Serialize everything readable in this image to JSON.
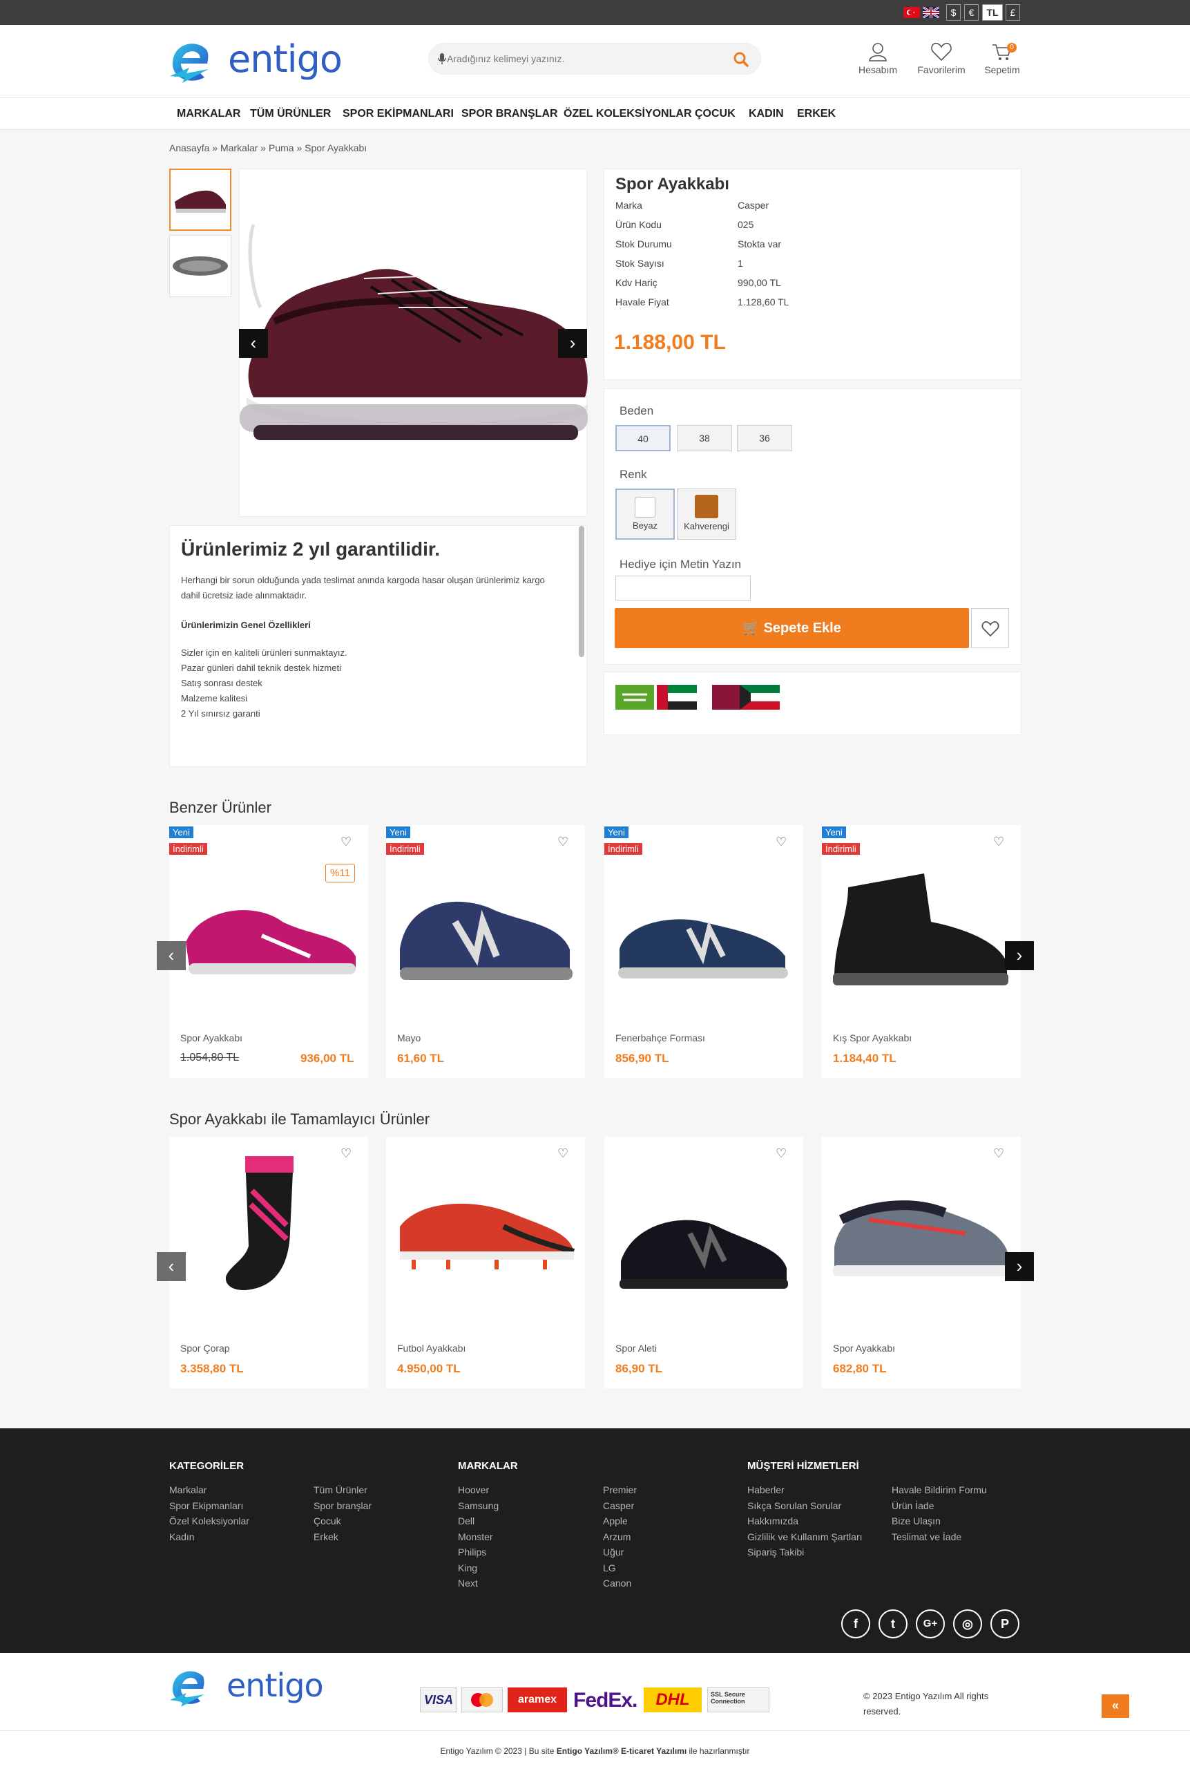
{
  "topbar": {
    "currencies": [
      "$",
      "€",
      "TL",
      "£"
    ],
    "active_currency": "TL",
    "languages": [
      "tr-flag",
      "uk-flag"
    ]
  },
  "header": {
    "logo_text": "entigo",
    "search_placeholder": "Aradığınız kelimeyi yazınız.",
    "account_label": "Hesabım",
    "favorites_label": "Favorilerim",
    "cart_label": "Sepetim",
    "cart_count": "0"
  },
  "nav": [
    "MARKALAR",
    "TÜM ÜRÜNLER",
    "SPOR EKİPMANLARI",
    "SPOR BRANŞLAR",
    "ÖZEL KOLEKSİYONLAR",
    "ÇOCUK",
    "KADIN",
    "ERKEK"
  ],
  "breadcrumb": [
    "Anasayfa",
    "Markalar",
    "Puma",
    "Spor Ayakkabı"
  ],
  "product": {
    "title": "Spor Ayakkabı",
    "specs": [
      {
        "label": "Marka",
        "value": "Casper"
      },
      {
        "label": "Ürün Kodu",
        "value": "025"
      },
      {
        "label": "Stok Durumu",
        "value": "Stokta var"
      },
      {
        "label": "Stok Sayısı",
        "value": "1"
      },
      {
        "label": "Kdv Hariç",
        "value": "990,00 TL"
      },
      {
        "label": "Havale Fiyat",
        "value": "1.128,60 TL"
      }
    ],
    "price": "1.188,00 TL",
    "size_label": "Beden",
    "sizes": [
      "40",
      "38",
      "36"
    ],
    "selected_size": "40",
    "color_label": "Renk",
    "colors": [
      {
        "name": "Beyaz",
        "hex": "#ffffff"
      },
      {
        "name": "Kahverengi",
        "hex": "#b5651d"
      }
    ],
    "gift_label": "Hediye için Metin Yazın",
    "gift_value": "",
    "add_to_cart": "Sepete Ekle"
  },
  "warranty": {
    "title": "Ürünlerimiz 2 yıl garantilidir.",
    "intro": "Herhangi bir sorun olduğunda yada teslimat anında kargoda hasar oluşan ürünlerimiz kargo dahil ücretsiz iade alınmaktadır.",
    "features_title": "Ürünlerimizin Genel Özellikleri",
    "features": [
      "Sizler için en kaliteli ürünleri sunmaktayız.",
      "Pazar günleri dahil teknik destek hizmeti",
      "Satış sonrası destek",
      "Malzeme kalitesi",
      "2 Yıl sınırsız garanti"
    ]
  },
  "similar": {
    "title": "Benzer Ürünler",
    "new_badge": "Yeni",
    "sale_badge": "İndirimli",
    "items": [
      {
        "name": "Spor Ayakkabı",
        "old_price": "1.054,80 TL",
        "price": "936,00 TL",
        "discount": "%11"
      },
      {
        "name": "Mayo",
        "old_price": "",
        "price": "61,60 TL",
        "discount": ""
      },
      {
        "name": "Fenerbahçe Forması",
        "old_price": "",
        "price": "856,90 TL",
        "discount": ""
      },
      {
        "name": "Kış Spor Ayakkabı",
        "old_price": "",
        "price": "1.184,40 TL",
        "discount": ""
      }
    ]
  },
  "complementary": {
    "title": "Spor Ayakkabı ile Tamamlayıcı Ürünler",
    "items": [
      {
        "name": "Spor Çorap",
        "price": "3.358,80 TL"
      },
      {
        "name": "Futbol Ayakkabı",
        "price": "4.950,00 TL"
      },
      {
        "name": "Spor Aleti",
        "price": "86,90 TL"
      },
      {
        "name": "Spor Ayakkabı",
        "price": "682,80 TL"
      }
    ]
  },
  "footer": {
    "categories_title": "KATEGORİLER",
    "categories_col1": [
      "Markalar",
      "Spor Ekipmanları",
      "Özel Koleksiyonlar",
      "Kadın"
    ],
    "categories_col2": [
      "Tüm Ürünler",
      "Spor branşlar",
      "Çocuk",
      "Erkek"
    ],
    "brands_title": "MARKALAR",
    "brands_col1": [
      "Hoover",
      "Samsung",
      "Dell",
      "Monster",
      "Philips",
      "King",
      "Next"
    ],
    "brands_col2": [
      "Premier",
      "Casper",
      "Apple",
      "Arzum",
      "Uğur",
      "LG",
      "Canon"
    ],
    "service_title": "MÜŞTERİ HİZMETLERİ",
    "service_col1": [
      "Haberler",
      "Sıkça Sorulan Sorular",
      "Hakkımızda",
      "Gizlilik ve Kullanım Şartları",
      "Sipariş Takibi"
    ],
    "service_col2": [
      "Havale Bildirim Formu",
      "Ürün İade",
      "Bize Ulaşın",
      "Teslimat ve İade"
    ],
    "social": [
      "f",
      "t",
      "G+",
      "◎",
      "P"
    ]
  },
  "bottom": {
    "logo_text": "entigo",
    "payments": [
      "VISA",
      "mastercard",
      "aramex",
      "FedEx.",
      "DHL",
      "SSL Secure Connection"
    ],
    "copyright": "© 2023 Entigo Yazılım All rights reserved.",
    "credit_prefix": "Entigo Yazılım © 2023 | Bu site ",
    "credit_bold": "Entigo Yazılım® E-ticaret Yazılımı",
    "credit_suffix": " ile hazırlanmıştır"
  },
  "colors": {
    "accent": "#f07c1e",
    "new_badge": "#1f7fd4",
    "sale_badge": "#e03b3b",
    "footer_bg": "#1e1e1e"
  }
}
